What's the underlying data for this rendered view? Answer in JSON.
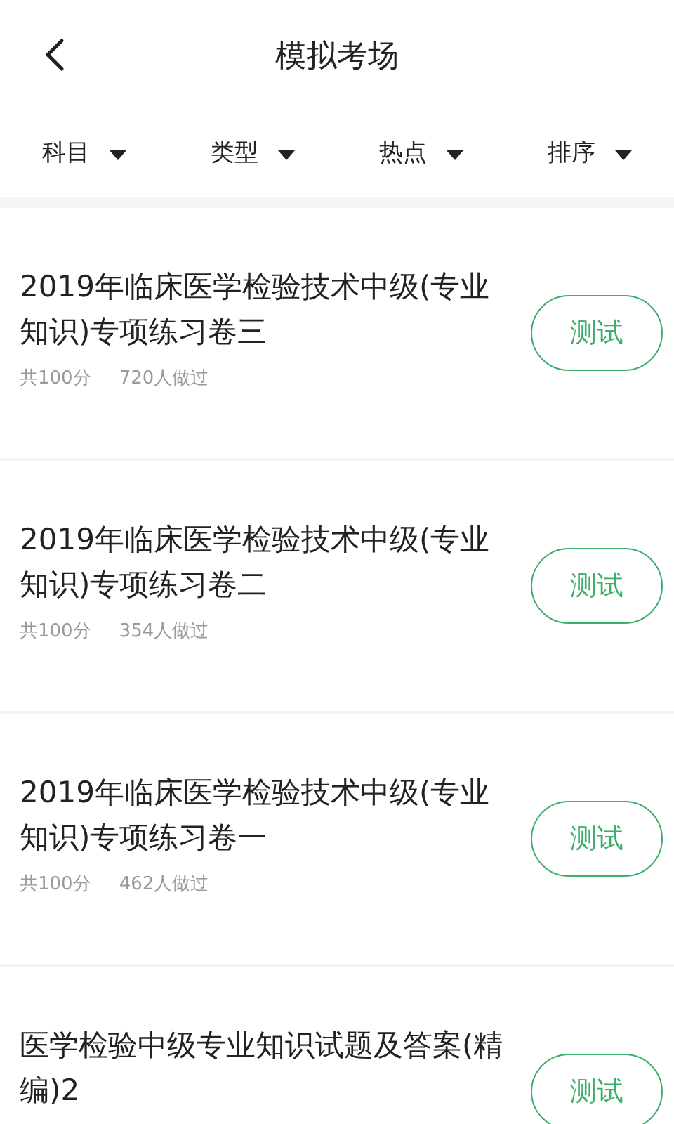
{
  "header": {
    "title": "模拟考场"
  },
  "filters": [
    {
      "label": "科目"
    },
    {
      "label": "类型"
    },
    {
      "label": "热点"
    },
    {
      "label": "排序"
    }
  ],
  "papers": [
    {
      "title": "2019年临床医学检验技术中级(专业知识)专项练习卷三",
      "score": "共100分",
      "takers": "720人做过",
      "action": "测试"
    },
    {
      "title": "2019年临床医学检验技术中级(专业知识)专项练习卷二",
      "score": "共100分",
      "takers": "354人做过",
      "action": "测试"
    },
    {
      "title": "2019年临床医学检验技术中级(专业知识)专项练习卷一",
      "score": "共100分",
      "takers": "462人做过",
      "action": "测试"
    },
    {
      "title": "医学检验中级专业知识试题及答案(精编)2",
      "action": "测试"
    }
  ]
}
